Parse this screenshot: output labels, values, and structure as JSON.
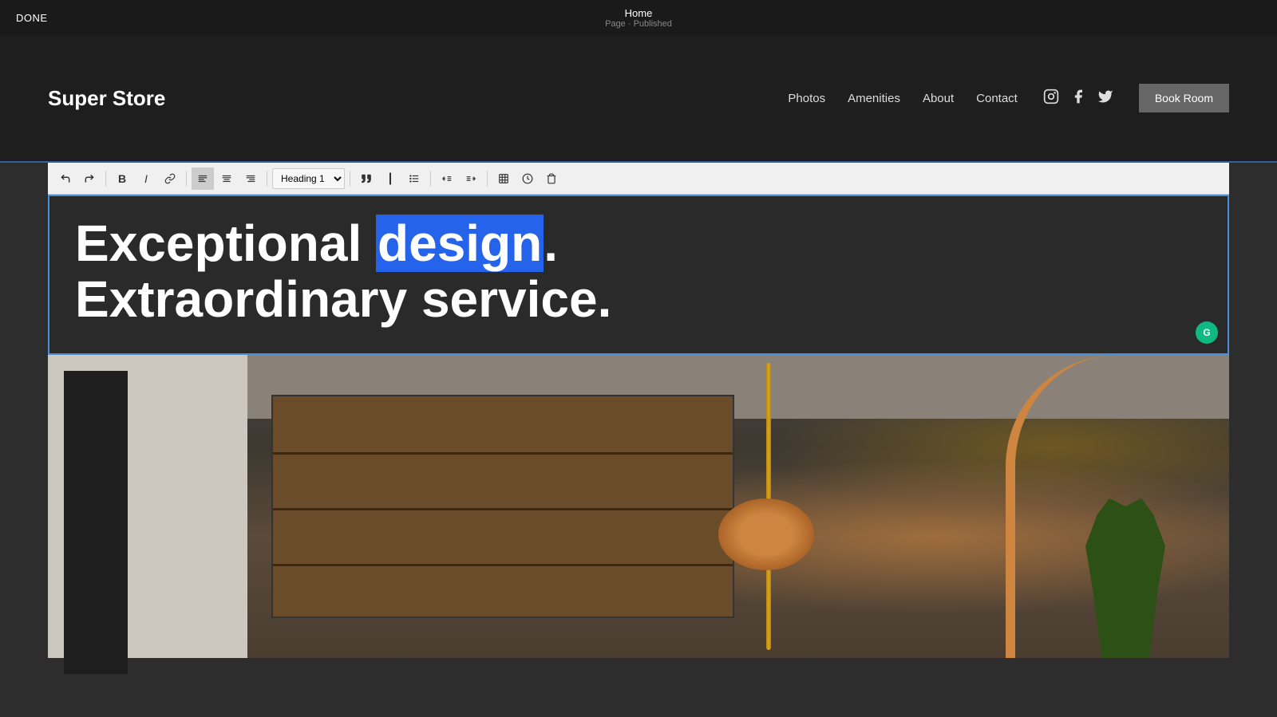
{
  "topbar": {
    "done_label": "DONE",
    "page_title": "Home",
    "page_subtitle": "Page · Published"
  },
  "nav": {
    "logo": "Super Store",
    "links": [
      "Photos",
      "Amenities",
      "About",
      "Contact"
    ],
    "icons": [
      "instagram",
      "facebook",
      "twitter"
    ],
    "cta_label": "Book Room"
  },
  "toolbar": {
    "heading_select": "Heading 1",
    "buttons": [
      "undo",
      "redo",
      "bold",
      "italic",
      "link",
      "align-left",
      "align-center",
      "align-right",
      "blockquote",
      "separator",
      "outdent",
      "indent",
      "insert-table",
      "clock",
      "trash"
    ]
  },
  "heading": {
    "line1_plain": "Exceptional ",
    "line1_highlighted": "design",
    "line1_suffix": ".",
    "line2": "Extraordinary service.",
    "avatar_initials": "G"
  },
  "colors": {
    "selection_blue": "#2563eb",
    "border_blue": "#4a90d9",
    "avatar_green": "#10b981",
    "nav_bg": "#1e1e1e",
    "site_bg": "#2a2a2a",
    "top_bar_bg": "#1a1a1a"
  }
}
